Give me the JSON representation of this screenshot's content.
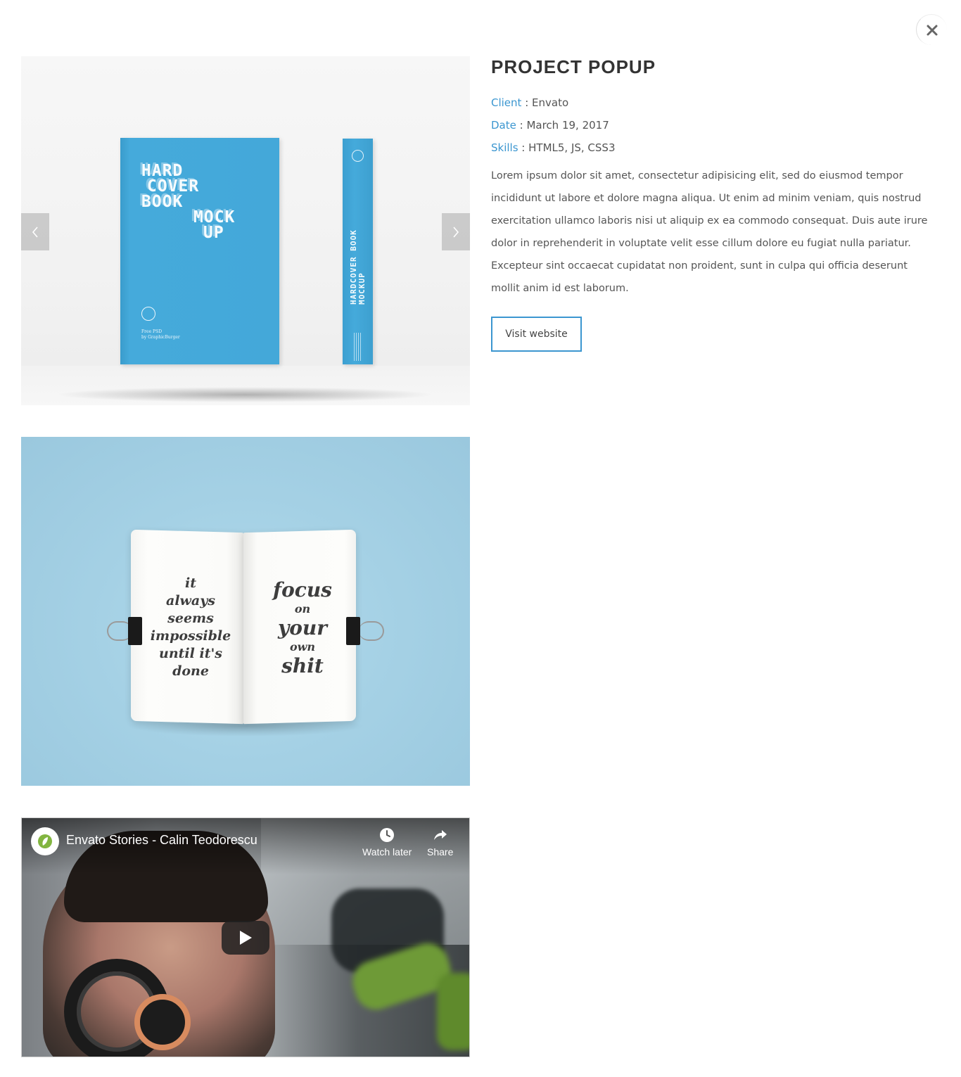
{
  "popup": {
    "title": "PROJECT POPUP",
    "meta": {
      "client_label": "Client",
      "client_value": " : Envato",
      "date_label": "Date",
      "date_value": " : March 19, 2017",
      "skills_label": "Skills",
      "skills_value": " : HTML5, JS, CSS3"
    },
    "description": "Lorem ipsum dolor sit amet, consectetur adipisicing elit, sed do eiusmod tempor incididunt ut labore et dolore magna aliqua. Ut enim ad minim veniam, quis nostrud exercitation ullamco laboris nisi ut aliquip ex ea commodo consequat. Duis aute irure dolor in reprehenderit in voluptate velit esse cillum dolore eu fugiat nulla pariatur. Excepteur sint occaecat cupidatat non proident, sunt in culpa qui officia deserunt mollit anim id est laborum.",
    "visit_button": "Visit website",
    "accent_color": "#3b96d0"
  },
  "slider": {
    "cover_lines": [
      "HARD",
      "COVER",
      "BOOK",
      "MOCK",
      "UP"
    ],
    "cover_small": [
      "Free PSD",
      "by GraphicBurger"
    ],
    "spine_text": "HARDCOVER BOOK MOCKUP",
    "prev_icon": "chevron-left-icon",
    "next_icon": "chevron-right-icon"
  },
  "notebook": {
    "left_quote": [
      "it",
      "always",
      "seems",
      "impossible",
      "until it's",
      "done"
    ],
    "right_quote": [
      "focus",
      "on",
      "your",
      "own",
      "shit"
    ]
  },
  "video": {
    "title": "Envato Stories - Calin Teodorescu",
    "watch_later": "Watch later",
    "share": "Share"
  }
}
